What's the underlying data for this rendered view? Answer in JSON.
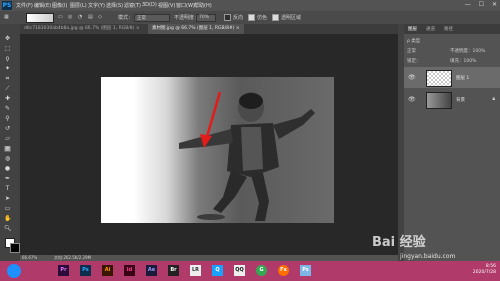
{
  "app": {
    "logo": "PS"
  },
  "menu": [
    "文件(F)",
    "编辑(E)",
    "图像(I)",
    "图层(L)",
    "文字(Y)",
    "选择(S)",
    "滤镜(T)",
    "3D(D)",
    "视图(V)",
    "窗口(W)",
    "帮助(H)"
  ],
  "window_controls": [
    "—",
    "☐",
    "✕"
  ],
  "options": {
    "mode_label": "模式：",
    "mode_value": "正常",
    "opacity_label": "不透明度：",
    "opacity_value": "70%",
    "reverse": "反向",
    "dither": "仿色",
    "transparency": "透明区域"
  },
  "tabs": [
    {
      "label": "d6c7183030ab4b8a.jpg @ 66.7% (图层 1, RGB/8) ×",
      "active": false
    },
    {
      "label": "素材图.jpg @ 66.7% (图层 1, RGB/8#) ×",
      "active": true
    }
  ],
  "status": {
    "zoom": "66.67%",
    "doc": "文档:262.5K/2.29M"
  },
  "panel": {
    "tabs": [
      "图层",
      "通道",
      "路径"
    ],
    "kind": "ρ 类型",
    "blend": "正常",
    "opacity_label": "不透明度：",
    "opacity_value": "100%",
    "lock_label": "锁定：",
    "fill_label": "填充：",
    "fill_value": "100%",
    "layers": [
      {
        "name": "图层 1",
        "active": true
      },
      {
        "name": "背景",
        "active": false
      }
    ]
  },
  "taskbar": {
    "apps": [
      "Pr",
      "Ps",
      "Ai",
      "Id",
      "Ae",
      "Br",
      "LR",
      "Q",
      "e",
      "QQ",
      "G",
      "Fx",
      "Ps"
    ],
    "time": "8:56",
    "date": "2020/7/28"
  },
  "watermark": {
    "brand": "Bai 经验",
    "url": "jingyan.baidu.com"
  },
  "colors": {
    "accent": "#ff0000",
    "taskbar": "#b03a6a"
  }
}
